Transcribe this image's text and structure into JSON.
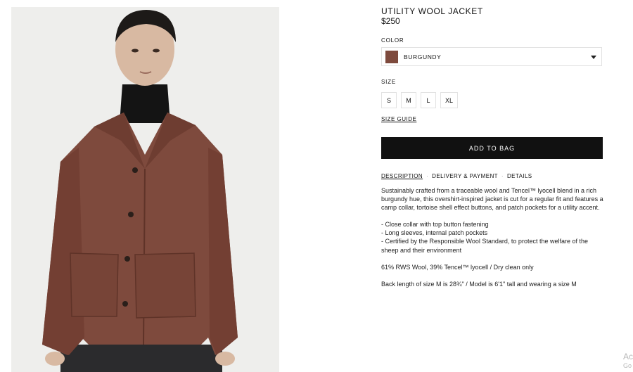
{
  "product": {
    "name": "UTILITY WOOL JACKET",
    "price": "$250"
  },
  "color": {
    "label": "COLOR",
    "selected": "BURGUNDY",
    "swatch": "#7e4a3d"
  },
  "size": {
    "label": "SIZE",
    "options": [
      "S",
      "M",
      "L",
      "XL"
    ],
    "guide": "SIZE GUIDE"
  },
  "cta": {
    "add_to_bag": "ADD TO BAG"
  },
  "tabs": [
    "DESCRIPTION",
    "DELIVERY & PAYMENT",
    "DETAILS"
  ],
  "description": {
    "intro": "Sustainably crafted from a traceable wool and Tencel™ lyocell blend in a rich burgundy hue, this overshirt-inspired jacket is cut for a regular fit and features a camp collar, tortoise shell effect buttons, and patch pockets for a utility accent.",
    "bullets": [
      "- Close collar with top button fastening",
      "- Long sleeves, internal patch pockets",
      "- Certified by the Responsible Wool Standard, to protect the welfare of the sheep and their environment"
    ],
    "composition": "61% RWS Wool, 39% Tencel™ lyocell / Dry clean only",
    "fit": "Back length of size M is 28¾\" / Model is 6'1\" tall and wearing a size M"
  },
  "watermark": {
    "line1": "Ac",
    "line2": "Go"
  },
  "colors": {
    "photo_bg": "#eeeeec",
    "jacket": "#7e4a3d",
    "button_black": "#111111"
  }
}
